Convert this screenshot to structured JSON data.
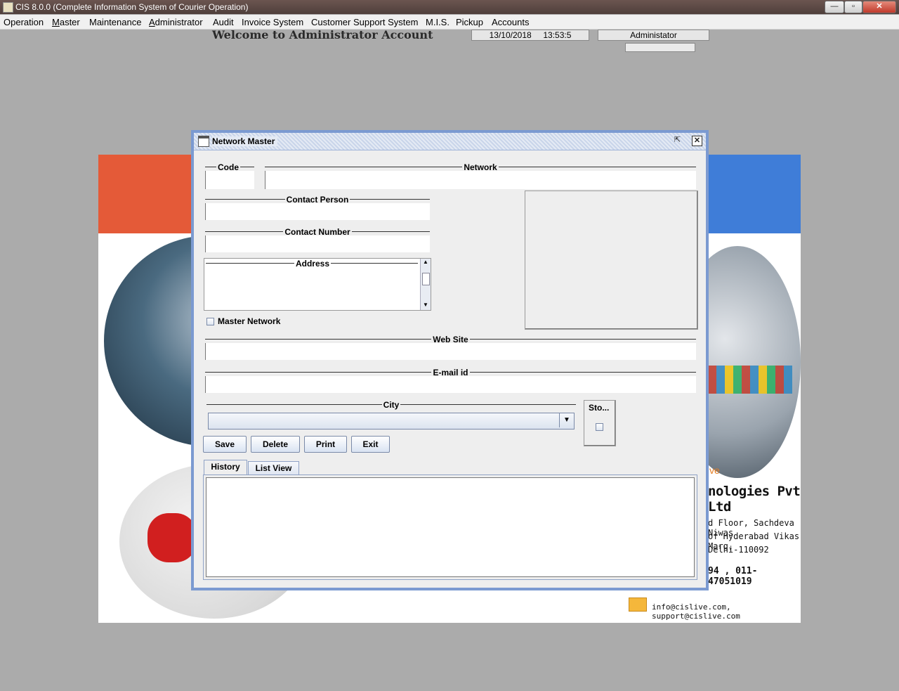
{
  "window": {
    "title": "CIS 8.0.0 (Complete Information System of Courier Operation)",
    "minimize": "—",
    "restore": "▫",
    "close": "✕"
  },
  "menu": [
    "Operation",
    "Master",
    "Maintenance",
    "Administrator",
    "Audit",
    "Invoice System",
    "Customer Support System",
    "M.I.S.",
    "Pickup",
    "Accounts"
  ],
  "header": {
    "welcome": "Welcome to Administrator Account",
    "date": "13/10/2018",
    "time": "13:53:5",
    "user": "Administator"
  },
  "poster": {
    "logo_text": "ve",
    "company": "nologies Pvt Ltd",
    "address_lines": [
      "d Floor, Sachdeva Niwas",
      "of Hyderabad Vikas Marg,",
      "Delhi-110092"
    ],
    "phone": "94 , 011-47051019",
    "email": "info@cislive.com, support@cislive.com"
  },
  "dialog": {
    "title": "Network Master",
    "fields": {
      "code": "Code",
      "network": "Network",
      "contact_person": "Contact Person",
      "contact_number": "Contact Number",
      "address": "Address",
      "master_network": "Master Network",
      "web_site": "Web Site",
      "email_id": "E-mail id",
      "city": "City",
      "sto": "Sto..."
    },
    "values": {
      "code": "",
      "network": "",
      "contact_person": "",
      "contact_number": "",
      "address": "",
      "web_site": "",
      "email_id": "",
      "city": ""
    },
    "buttons": {
      "save": "Save",
      "delete": "Delete",
      "print": "Print",
      "exit": "Exit"
    },
    "tabs": [
      "History",
      "List View"
    ],
    "active_tab": "History"
  },
  "colors": {
    "desktop": "#ababab",
    "frame_border": "#7b9ad1",
    "poster_orange": "#e45a38",
    "poster_blue": "#3f7dd8"
  }
}
